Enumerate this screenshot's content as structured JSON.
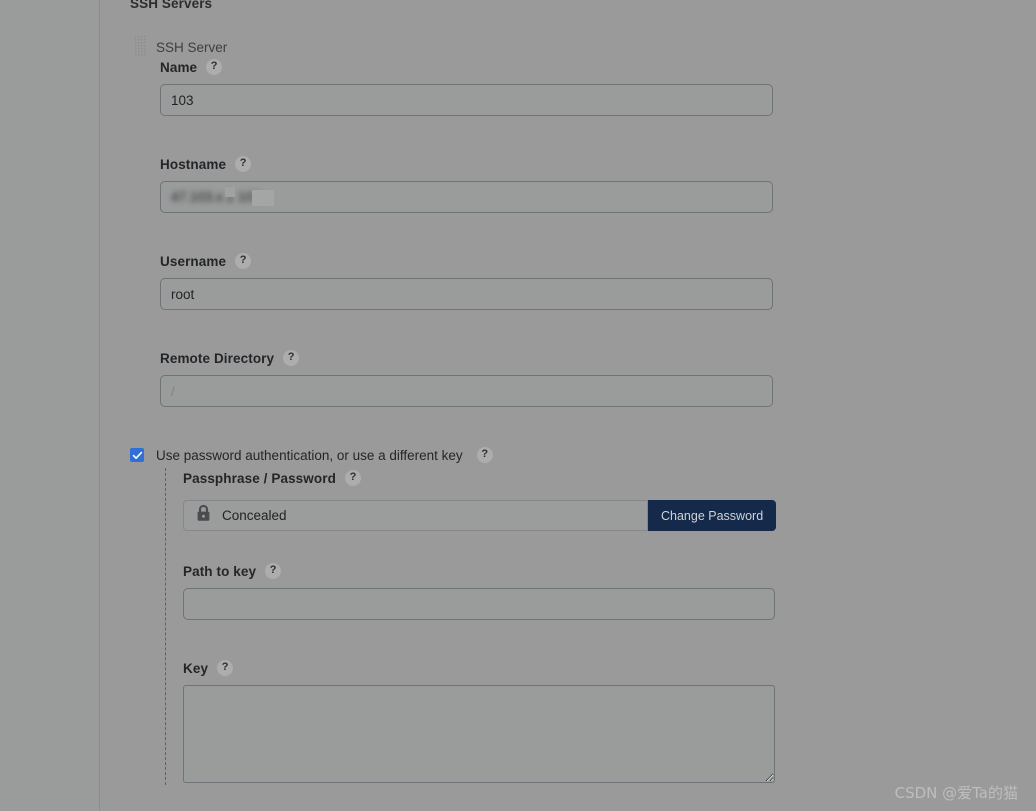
{
  "section": {
    "title": "SSH Servers",
    "item_label": "SSH Server",
    "drag_handle_icon": "drag-dots-icon"
  },
  "help_badge_glyph": "?",
  "fields": {
    "name": {
      "label": "Name",
      "value": "103",
      "placeholder": ""
    },
    "hostname": {
      "label": "Hostname",
      "value": "47.103.x.1 103",
      "placeholder": "",
      "redacted": true
    },
    "username": {
      "label": "Username",
      "value": "root",
      "placeholder": ""
    },
    "remote_directory": {
      "label": "Remote Directory",
      "value": "",
      "placeholder": "/"
    },
    "passphrase": {
      "label": "Passphrase / Password",
      "value": "Concealed",
      "lock_icon": "lock-icon",
      "button_label": "Change Password"
    },
    "path_to_key": {
      "label": "Path to key",
      "value": "",
      "placeholder": ""
    },
    "key": {
      "label": "Key",
      "value": "",
      "placeholder": ""
    }
  },
  "checkbox": {
    "label": "Use password authentication, or use a different key",
    "checked": true
  },
  "watermark": "CSDN @爱Ta的猫",
  "colors": {
    "page_background": "#9a9a9a",
    "input_border": "#6e7377",
    "label_text": "#232629",
    "checkbox_accent": "#2f6fd6",
    "button_background": "#15294a",
    "button_text": "#cfd3d8",
    "help_badge_background": "#adadad",
    "nesting_guide": "#5d6165"
  }
}
